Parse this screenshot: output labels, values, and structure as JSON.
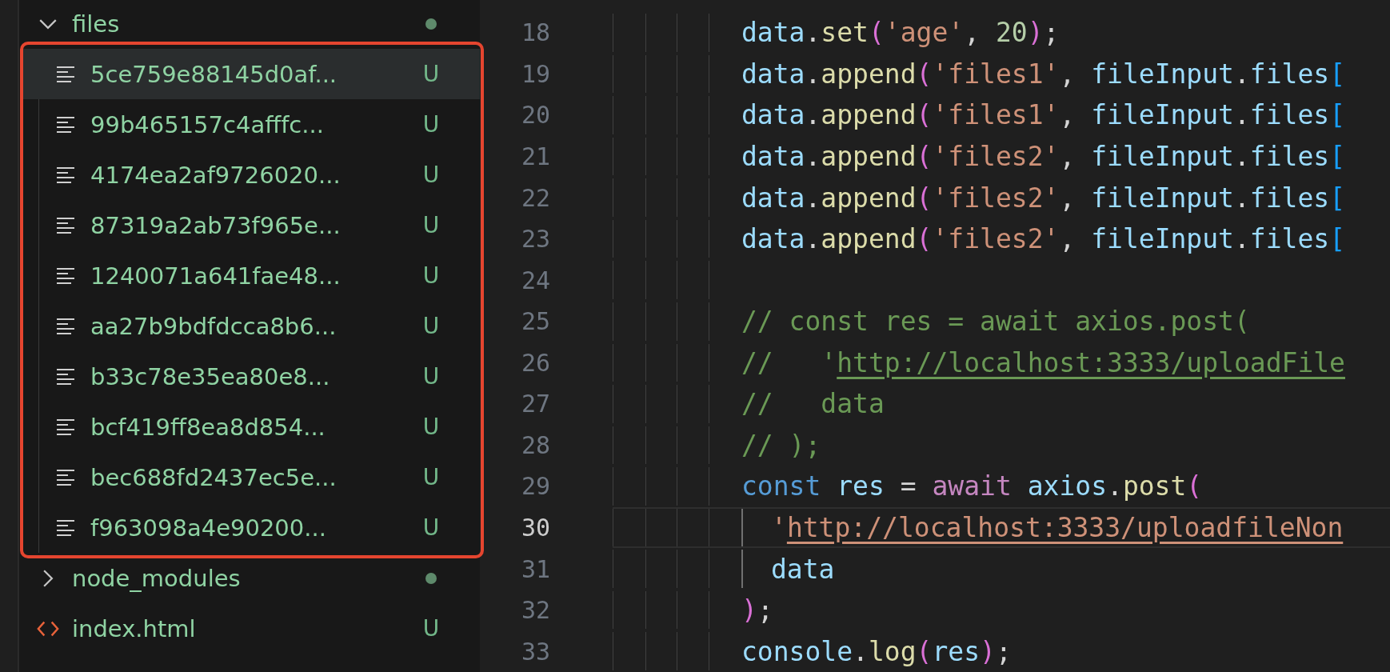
{
  "explorer": {
    "items": [
      {
        "kind": "folder",
        "name": "files",
        "expanded": true,
        "modified_dot": true,
        "children": [
          {
            "kind": "text",
            "name": "5ce759e88145d0af...",
            "badge": "U",
            "selected": true
          },
          {
            "kind": "text",
            "name": "99b465157c4afffc...",
            "badge": "U",
            "selected": false
          },
          {
            "kind": "text",
            "name": "4174ea2af9726020...",
            "badge": "U",
            "selected": false
          },
          {
            "kind": "text",
            "name": "87319a2ab73f965e...",
            "badge": "U",
            "selected": false
          },
          {
            "kind": "text",
            "name": "1240071a641fae48...",
            "badge": "U",
            "selected": false
          },
          {
            "kind": "text",
            "name": "aa27b9bdfdcca8b6...",
            "badge": "U",
            "selected": false
          },
          {
            "kind": "text",
            "name": "b33c78e35ea80e8...",
            "badge": "U",
            "selected": false
          },
          {
            "kind": "text",
            "name": "bcf419ff8ea8d854...",
            "badge": "U",
            "selected": false
          },
          {
            "kind": "text",
            "name": "bec688fd2437ec5e...",
            "badge": "U",
            "selected": false
          },
          {
            "kind": "text",
            "name": "f963098a4e90200...",
            "badge": "U",
            "selected": false
          }
        ]
      },
      {
        "kind": "folder",
        "name": "node_modules",
        "expanded": false,
        "modified_dot": true
      },
      {
        "kind": "html",
        "name": "index.html",
        "badge": "U",
        "selected": false
      }
    ]
  },
  "editor": {
    "lines": [
      {
        "number": "18",
        "current": false,
        "tokens": [
          {
            "kind": "var",
            "text": "data"
          },
          {
            "kind": "method",
            "text": ".set"
          },
          {
            "kind": "paren",
            "text": "("
          },
          {
            "kind": "str",
            "text": "'age'"
          },
          {
            "kind": "punct",
            "text": ", "
          },
          {
            "kind": "num",
            "text": "20"
          },
          {
            "kind": "paren",
            "text": ")"
          },
          {
            "kind": "punct",
            "text": ";"
          }
        ]
      },
      {
        "number": "19",
        "current": false,
        "tokens": [
          {
            "kind": "var",
            "text": "data"
          },
          {
            "kind": "method",
            "text": ".append"
          },
          {
            "kind": "paren",
            "text": "("
          },
          {
            "kind": "str",
            "text": "'files1'"
          },
          {
            "kind": "punct",
            "text": ", "
          },
          {
            "kind": "var",
            "text": "fileInput"
          },
          {
            "kind": "property",
            "text": ".files"
          },
          {
            "kind": "bracket",
            "text": "["
          }
        ]
      },
      {
        "number": "20",
        "current": false,
        "tokens": [
          {
            "kind": "var",
            "text": "data"
          },
          {
            "kind": "method",
            "text": ".append"
          },
          {
            "kind": "paren",
            "text": "("
          },
          {
            "kind": "str",
            "text": "'files1'"
          },
          {
            "kind": "punct",
            "text": ", "
          },
          {
            "kind": "var",
            "text": "fileInput"
          },
          {
            "kind": "property",
            "text": ".files"
          },
          {
            "kind": "bracket",
            "text": "["
          }
        ]
      },
      {
        "number": "21",
        "current": false,
        "tokens": [
          {
            "kind": "var",
            "text": "data"
          },
          {
            "kind": "method",
            "text": ".append"
          },
          {
            "kind": "paren",
            "text": "("
          },
          {
            "kind": "str",
            "text": "'files2'"
          },
          {
            "kind": "punct",
            "text": ", "
          },
          {
            "kind": "var",
            "text": "fileInput"
          },
          {
            "kind": "property",
            "text": ".files"
          },
          {
            "kind": "bracket",
            "text": "["
          }
        ]
      },
      {
        "number": "22",
        "current": false,
        "tokens": [
          {
            "kind": "var",
            "text": "data"
          },
          {
            "kind": "method",
            "text": ".append"
          },
          {
            "kind": "paren",
            "text": "("
          },
          {
            "kind": "str",
            "text": "'files2'"
          },
          {
            "kind": "punct",
            "text": ", "
          },
          {
            "kind": "var",
            "text": "fileInput"
          },
          {
            "kind": "property",
            "text": ".files"
          },
          {
            "kind": "bracket",
            "text": "["
          }
        ]
      },
      {
        "number": "23",
        "current": false,
        "tokens": [
          {
            "kind": "var",
            "text": "data"
          },
          {
            "kind": "method",
            "text": ".append"
          },
          {
            "kind": "paren",
            "text": "("
          },
          {
            "kind": "str",
            "text": "'files2'"
          },
          {
            "kind": "punct",
            "text": ", "
          },
          {
            "kind": "var",
            "text": "fileInput"
          },
          {
            "kind": "property",
            "text": ".files"
          },
          {
            "kind": "bracket",
            "text": "["
          }
        ]
      },
      {
        "number": "24",
        "current": false
      },
      {
        "number": "25",
        "current": false,
        "tokens": [
          {
            "kind": "comment",
            "text": "// const res = await axios.post("
          }
        ]
      },
      {
        "number": "26",
        "current": false,
        "tokens": [
          {
            "kind": "comment",
            "text": "//   '"
          },
          {
            "kind": "comment_link",
            "text": "http://localhost:3333/uploadFile"
          }
        ]
      },
      {
        "number": "27",
        "current": false,
        "tokens": [
          {
            "kind": "comment",
            "text": "//   data"
          }
        ]
      },
      {
        "number": "28",
        "current": false,
        "tokens": [
          {
            "kind": "comment",
            "text": "// );"
          }
        ]
      },
      {
        "number": "29",
        "current": false,
        "tokens": [
          {
            "kind": "keyword",
            "text": "const "
          },
          {
            "kind": "var",
            "text": "res"
          },
          {
            "kind": "punct",
            "text": " = "
          },
          {
            "kind": "control",
            "text": "await "
          },
          {
            "kind": "var",
            "text": "axios"
          },
          {
            "kind": "method",
            "text": ".post"
          },
          {
            "kind": "paren",
            "text": "("
          }
        ]
      },
      {
        "number": "30",
        "current": true,
        "in_block": true,
        "tokens": [
          {
            "kind": "str",
            "text": "'"
          },
          {
            "kind": "str_link",
            "text": "http://localhost:3333/uploadfileNon"
          }
        ]
      },
      {
        "number": "31",
        "current": false,
        "in_block": true,
        "tokens": [
          {
            "kind": "var",
            "text": "data"
          }
        ]
      },
      {
        "number": "32",
        "current": false,
        "tokens": [
          {
            "kind": "paren",
            "text": ")"
          },
          {
            "kind": "punct",
            "text": ";"
          }
        ]
      },
      {
        "number": "33",
        "current": false,
        "tokens": [
          {
            "kind": "var",
            "text": "console"
          },
          {
            "kind": "method",
            "text": ".log"
          },
          {
            "kind": "paren",
            "text": "("
          },
          {
            "kind": "var",
            "text": "res"
          },
          {
            "kind": "paren",
            "text": ")"
          },
          {
            "kind": "punct",
            "text": ";"
          }
        ]
      }
    ]
  }
}
